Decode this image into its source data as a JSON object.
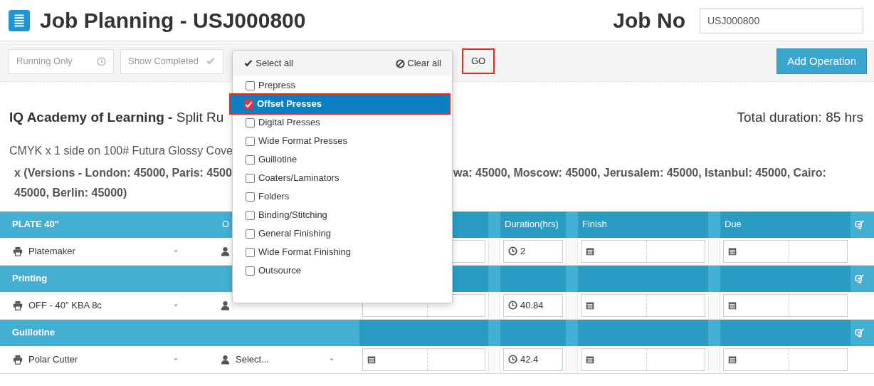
{
  "header": {
    "title": "Job Planning - USJ000800",
    "job_no_label": "Job No",
    "job_no_value": "USJ000800"
  },
  "toolbar": {
    "filters": [
      {
        "label": "Running Only",
        "kind": "clock"
      },
      {
        "label": "Show Completed",
        "kind": "check"
      }
    ],
    "go_button": {
      "label": "GO",
      "highlighted": true
    },
    "add_button": "Add Operation"
  },
  "dropdown": {
    "select_all": "Select all",
    "clear_all": "Clear all",
    "items": [
      {
        "label": "Prepress",
        "checked": false,
        "selected": false
      },
      {
        "label": "Offset Presses",
        "checked": true,
        "selected": true
      },
      {
        "label": "Digital Presses",
        "checked": false,
        "selected": false
      },
      {
        "label": "Wide Format Presses",
        "checked": false,
        "selected": false
      },
      {
        "label": "Guillotine",
        "checked": false,
        "selected": false
      },
      {
        "label": "Coaters/Laminators",
        "checked": false,
        "selected": false
      },
      {
        "label": "Folders",
        "checked": false,
        "selected": false
      },
      {
        "label": "Binding/Stitching",
        "checked": false,
        "selected": false
      },
      {
        "label": "General Finishing",
        "checked": false,
        "selected": false
      },
      {
        "label": "Wide Format Finishing",
        "checked": false,
        "selected": false
      },
      {
        "label": "Outsource",
        "checked": false,
        "selected": false
      }
    ]
  },
  "job": {
    "title": "**IQ Academy of Learning -** Split Ru",
    "total": "Total duration: 85 hrs",
    "spec": "CMYK x 1 side on 100# Futura Glossy Cove",
    "versions_left": "x (Versions - London: 45000, Paris: 4500",
    "versions_right": "wa: 45000, Moscow: 45000, Jerusalem: 45000, Istanbul: 45000, Cairo:",
    "versions_end": "45000, Berlin: 45000)"
  },
  "table": {
    "columns": [
      "O",
      "Duration(hrs)",
      "Finish",
      "Due"
    ],
    "groups": [
      {
        "name": "PLATE 40\"",
        "rows": [
          {
            "machine": "Platemaker",
            "duration": "2"
          }
        ]
      },
      {
        "name": "Printing",
        "rows": [
          {
            "machine": "OFF - 40\" KBA 8c",
            "duration": "40.84"
          }
        ]
      },
      {
        "name": "Guillotine",
        "rows": [
          {
            "machine": "Polar Cutter",
            "operator": "Select...",
            "duration": "42.4"
          }
        ]
      }
    ]
  }
}
